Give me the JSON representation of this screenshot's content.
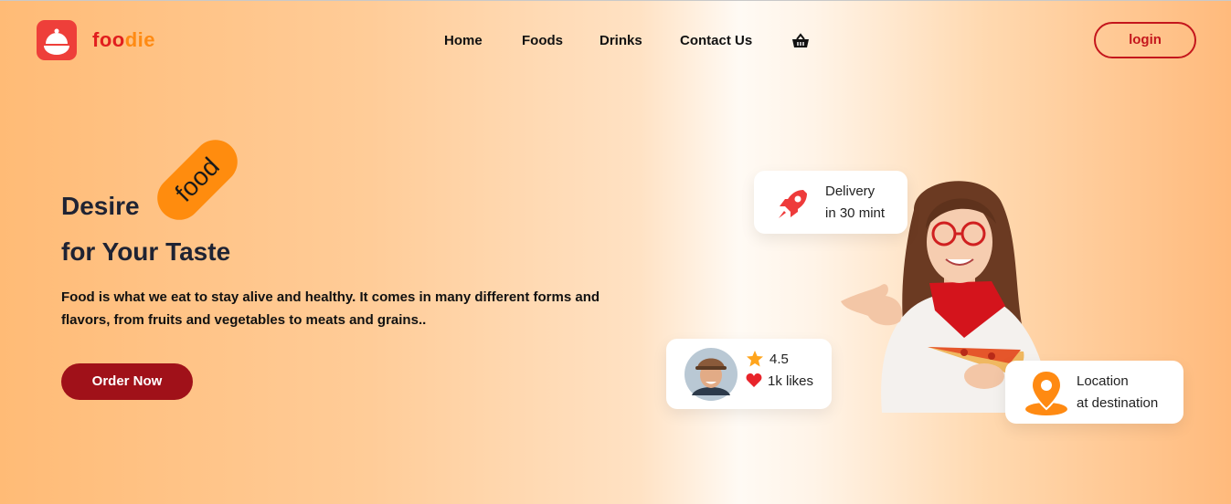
{
  "brand": {
    "part1": "foo",
    "part2": "die"
  },
  "nav": {
    "home": "Home",
    "foods": "Foods",
    "drinks": "Drinks",
    "contact": "Contact Us"
  },
  "header": {
    "login": "login"
  },
  "hero": {
    "desire": "Desire",
    "tag": "food",
    "taste": "for Your Taste",
    "description": "Food is what we eat to stay alive and healthy. It comes in many different forms and flavors, from fruits and vegetables to meats and grains..",
    "cta": "Order Now"
  },
  "cards": {
    "delivery": {
      "line1": "Delivery",
      "line2": "in 30 mint"
    },
    "rating": {
      "score": "4.5",
      "likes": "1k likes"
    },
    "location": {
      "line1": "Location",
      "line2": "at destination"
    }
  },
  "colors": {
    "accent": "#ff8c0e",
    "brand_red": "#e11e1e",
    "cta": "#a01119",
    "login": "#c4161c"
  },
  "icons": [
    "food-cloche-icon",
    "basket-icon",
    "rocket-icon",
    "star-icon",
    "heart-icon",
    "location-pin-icon"
  ]
}
